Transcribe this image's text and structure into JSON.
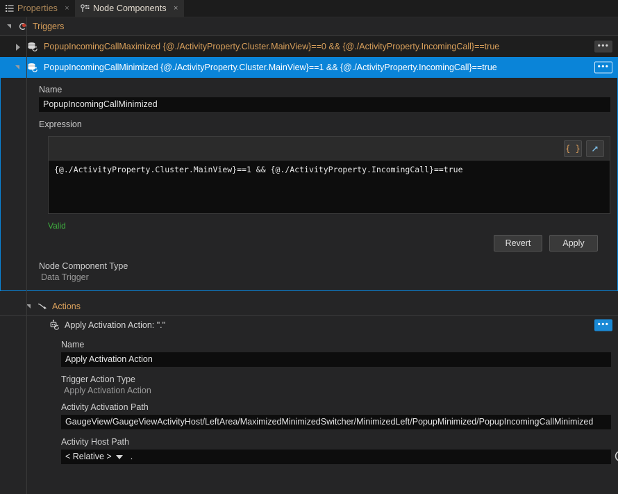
{
  "window": {
    "tabs": [
      {
        "label": "Properties",
        "icon": "list-icon",
        "active": false,
        "close": "×"
      },
      {
        "label": "Node Components",
        "icon": "node-components-icon",
        "active": true,
        "close": "×"
      }
    ]
  },
  "triggers_section": {
    "title": "Triggers",
    "icon": "trigger-refresh-icon",
    "expanded": true,
    "rows": [
      {
        "name": "PopupIncomingCallMaximized",
        "expression": "{@./ActivityProperty.Cluster.MainView}==0 && {@./ActivityProperty.IncomingCall}==true",
        "text": "PopupIncomingCallMaximized {@./ActivityProperty.Cluster.MainView}==0 && {@./ActivityProperty.IncomingCall}==true",
        "selected": false,
        "expanded": false,
        "menu_label": "•••"
      },
      {
        "name": "PopupIncomingCallMinimized",
        "expression": "{@./ActivityProperty.Cluster.MainView}==1 && {@./ActivityProperty.IncomingCall}==true",
        "text": "PopupIncomingCallMinimized {@./ActivityProperty.Cluster.MainView}==1 && {@./ActivityProperty.IncomingCall}==true",
        "selected": true,
        "expanded": true,
        "menu_label": "•••"
      }
    ]
  },
  "trigger_detail": {
    "name_label": "Name",
    "name_value": "PopupIncomingCallMinimized",
    "expression_label": "Expression",
    "expression_value": "{@./ActivityProperty.Cluster.MainView}==1 && {@./ActivityProperty.IncomingCall}==true",
    "toolbar": {
      "braces_label": "{ }",
      "expand_icon": "open-external-icon"
    },
    "validation_text": "Valid",
    "validation_color": "#3fae3f",
    "revert_label": "Revert",
    "apply_label": "Apply",
    "node_component_type_label": "Node Component Type",
    "node_component_type_value": "Data Trigger"
  },
  "actions_section": {
    "title": "Actions",
    "icon": "action-arrow-icon",
    "expanded": true,
    "action": {
      "header": "Apply Activation Action: \".\"",
      "icon": "activation-action-icon",
      "menu_label": "•••",
      "name_label": "Name",
      "name_value": "Apply Activation Action",
      "trigger_action_type_label": "Trigger Action Type",
      "trigger_action_type_value": "Apply Activation Action",
      "activity_activation_path_label": "Activity Activation Path",
      "activity_activation_path_value": "GaugeView/GaugeViewActivityHost/LeftArea/MaximizedMinimizedSwitcher/MinimizedLeft/PopupMinimized/PopupIncomingCallMinimized",
      "activity_host_path_label": "Activity Host Path",
      "activity_host_path_mode": "< Relative >",
      "activity_host_path_value": ".",
      "reset_icon": "reset-circle-arrow-icon"
    }
  },
  "colors": {
    "accent_blue": "#0a84d8",
    "amber": "#d9a05b",
    "valid_green": "#3fae3f",
    "panel_bg": "#252526",
    "field_bg": "#0d0d0d"
  }
}
